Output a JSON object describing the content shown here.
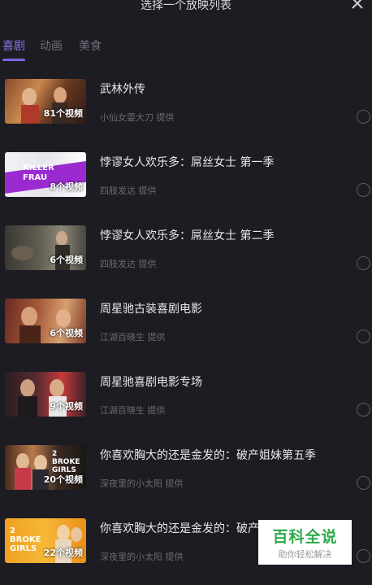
{
  "header": {
    "title": "选择一个放映列表",
    "close_icon": "close-icon"
  },
  "tabs": [
    {
      "label": "喜剧",
      "active": true
    },
    {
      "label": "动画",
      "active": false
    },
    {
      "label": "美食",
      "active": false
    }
  ],
  "playlists": [
    {
      "title": "武林外传",
      "provider": "小仙女耍大刀 提供",
      "count": "81个视频"
    },
    {
      "title": "悖谬女人欢乐多：屌丝女士 第一季",
      "provider": "四肢发达 提供",
      "count": "8个视频"
    },
    {
      "title": "悖谬女人欢乐多：屌丝女士 第二季",
      "provider": "四肢发达 提供",
      "count": "6个视频"
    },
    {
      "title": "周星驰古装喜剧电影",
      "provider": "江湖百晓生 提供",
      "count": "6个视频"
    },
    {
      "title": "周星驰喜剧电影专场",
      "provider": "江湖百晓生 提供",
      "count": "9个视频"
    },
    {
      "title": "你喜欢胸大的还是金发的：破产姐妹第五季",
      "provider": "深夜里的小太阳 提供",
      "count": "20个视频"
    },
    {
      "title": "你喜欢胸大的还是金发的：破产",
      "provider": "深夜里的小太阳 提供",
      "count": "22个视频"
    }
  ],
  "thumb_text": {
    "t2": "KILLER FRAU",
    "t6": "2 BROKE GIRLS",
    "t7": "2 BROKE GIRLS"
  },
  "watermark": {
    "main": "百科全说",
    "sub": "助你轻松解决"
  }
}
